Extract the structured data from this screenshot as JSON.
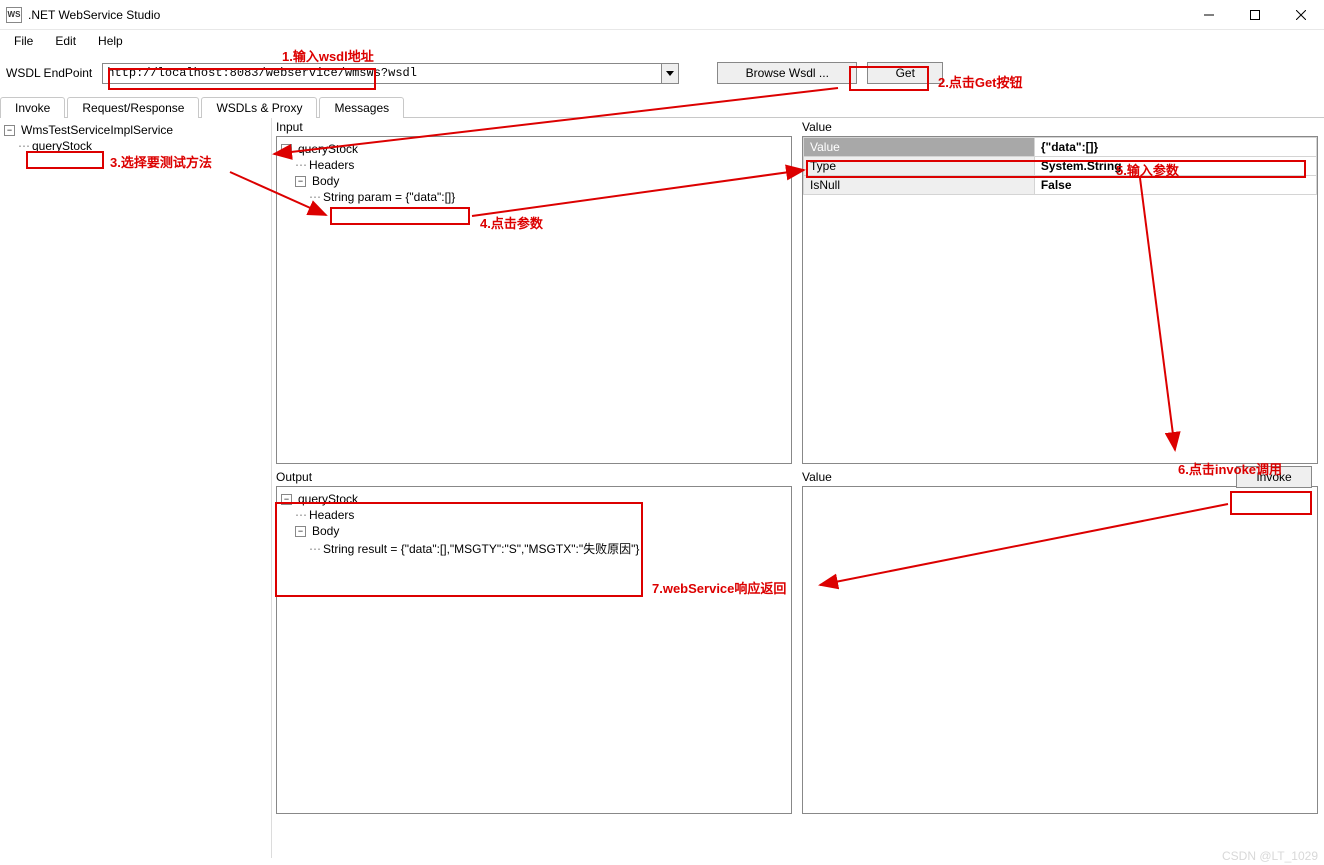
{
  "title": ".NET WebService Studio",
  "menu": {
    "file": "File",
    "edit": "Edit",
    "help": "Help"
  },
  "endpoint": {
    "label": "WSDL EndPoint",
    "value": "http://localhost:8083/webservice/wmsWs?wsdl",
    "browse_label": "Browse Wsdl ...",
    "get_label": "Get"
  },
  "tabs": {
    "invoke": "Invoke",
    "reqres": "Request/Response",
    "wsdls": "WSDLs & Proxy",
    "messages": "Messages"
  },
  "sidebar": {
    "service": "WmsTestServiceImplService",
    "method": "queryStock"
  },
  "panes": {
    "input_label": "Input",
    "value_label_top": "Value",
    "output_label": "Output",
    "value_label_bottom": "Value"
  },
  "input_tree": {
    "root": "queryStock",
    "headers": "Headers",
    "body": "Body",
    "param": "String param = {\"data\":[]}"
  },
  "value_grid": {
    "rows": [
      {
        "k": "Value",
        "v": "{\"data\":[]}"
      },
      {
        "k": "Type",
        "v": "System.String"
      },
      {
        "k": "IsNull",
        "v": "False"
      }
    ]
  },
  "output_tree": {
    "root": "queryStock",
    "headers": "Headers",
    "body": "Body",
    "result": "String result = {\"data\":[],\"MSGTY\":\"S\",\"MSGTX\":\"失败原因\"}"
  },
  "invoke_btn": "Invoke",
  "annotations": {
    "a1": "1.输入wsdl地址",
    "a2": "2.点击Get按钮",
    "a3": "3.选择要测试方法",
    "a4": "4.点击参数",
    "a5": "5.输入参数",
    "a6": "6.点击invoke调用",
    "a7": "7.webService响应返回"
  },
  "watermark": "CSDN @LT_1029"
}
